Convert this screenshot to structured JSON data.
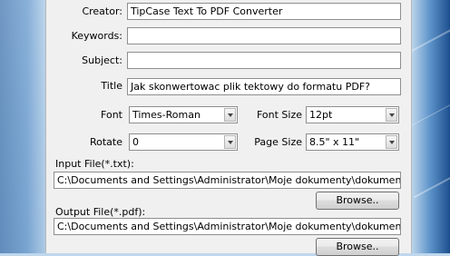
{
  "form": {
    "creator": {
      "label": "Creator:",
      "value": "TipCase Text To PDF Converter"
    },
    "keywords": {
      "label": "Keywords:",
      "value": ""
    },
    "subject": {
      "label": "Subject:",
      "value": ""
    },
    "title": {
      "label": "Title",
      "value": "Jak skonwertowac plik tektowy do formatu PDF?"
    },
    "font": {
      "label": "Font",
      "value": "Times-Roman"
    },
    "font_size": {
      "label": "Font Size",
      "value": "12pt"
    },
    "rotate": {
      "label": "Rotate",
      "value": "0"
    },
    "page_size": {
      "label": "Page Size",
      "value": "8.5\" x 11\""
    },
    "input_file": {
      "label": "Input File(*.txt):",
      "value": "C:\\Documents and Settings\\Administrator\\Moje dokumenty\\dokument.txt",
      "browse_label": "Browse.."
    },
    "output_file": {
      "label": "Output File(*.pdf):",
      "value": "C:\\Documents and Settings\\Administrator\\Moje dokumenty\\dokument.pdf",
      "browse_label": "Browse.."
    }
  }
}
